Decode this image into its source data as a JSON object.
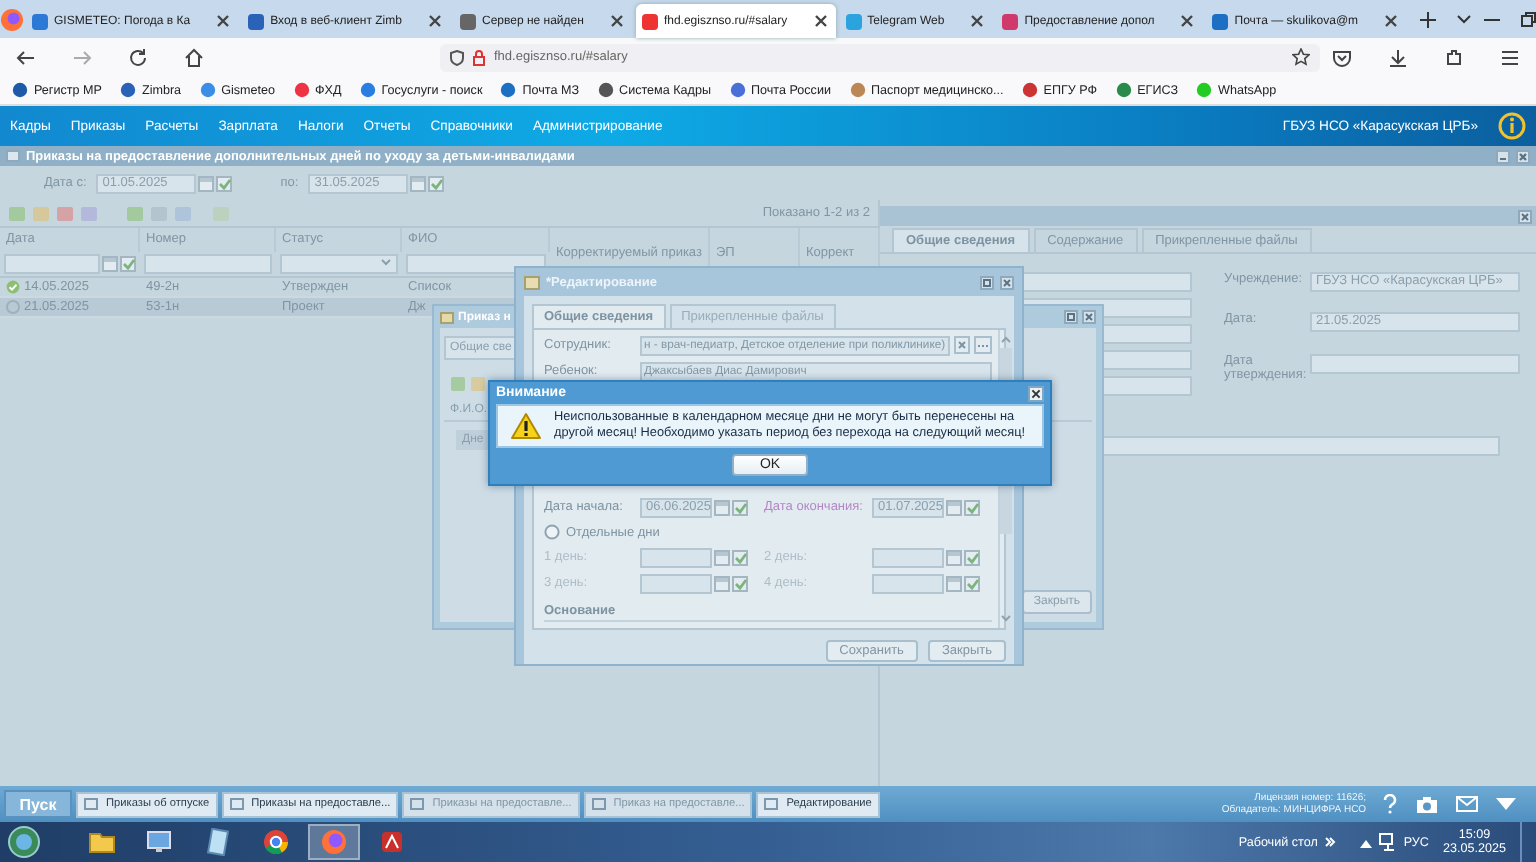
{
  "browser": {
    "tabs": [
      {
        "label": "GISMETEO: Погода в Ка",
        "selected": false
      },
      {
        "label": "Вход в веб-клиент Zimb",
        "selected": false
      },
      {
        "label": "Сервер не найден",
        "selected": false
      },
      {
        "label": "fhd.egisznso.ru/#salary",
        "selected": true
      },
      {
        "label": "Telegram Web",
        "selected": false
      },
      {
        "label": "Предоставление допол",
        "selected": false
      },
      {
        "label": "Почта — skulikova@m",
        "selected": false
      }
    ],
    "address": "fhd.egisznso.ru/#salary",
    "bookmarks": [
      "Регистр МР",
      "Zimbra",
      "Gismeteo",
      "ФХД",
      "Госуслуги - поиск",
      "Почта МЗ",
      "Система Кадры",
      "Почта России",
      "Паспорт медицинско...",
      "ЕПГУ РФ",
      "ЕГИСЗ",
      "WhatsApp"
    ]
  },
  "menu": {
    "items": [
      "Кадры",
      "Приказы",
      "Расчеты",
      "Зарплата",
      "Налоги",
      "Отчеты",
      "Справочники",
      "Администрирование"
    ],
    "organization": "ГБУЗ НСО «Карасукская ЦРБ»"
  },
  "main_window": {
    "title": "Приказы на предоставление дополнительных дней по уходу за детьми-инвалидами",
    "date_from_label": "Дата с:",
    "date_from": "01.05.2025",
    "date_to_label": "по:",
    "date_to": "31.05.2025",
    "shown": "Показано 1-2 из 2",
    "columns": [
      "Дата",
      "Номер",
      "Статус",
      "ФИО",
      "Корректируемый приказ",
      "ЭП",
      "Коррект"
    ],
    "rows": [
      {
        "kind": "approved",
        "selected": false,
        "cells": [
          "14.05.2025",
          "49-2н",
          "Утвержден",
          "Список"
        ]
      },
      {
        "kind": "draft",
        "selected": true,
        "cells": [
          "21.05.2025",
          "53-1н",
          "Проект",
          "Дж"
        ]
      }
    ],
    "detail": {
      "tabs": [
        {
          "label": "Общие сведения",
          "selected": true
        },
        {
          "label": "Содержание",
          "selected": false
        },
        {
          "label": "Прикрепленные файлы",
          "selected": false
        }
      ],
      "fields": [
        {
          "label": "Учреждение:",
          "value": "ГБУЗ НСО «Карасукская ЦРБ»"
        },
        {
          "label": "Дата:",
          "value": "21.05.2025"
        },
        {
          "label": "Дата утверждения:"
        }
      ]
    }
  },
  "order_window": {
    "title": "Приказ н",
    "tab": "Общие све",
    "column": "Ф.И.О.",
    "row_header": "Дне",
    "button": "Закрыть"
  },
  "edit_window": {
    "title": "*Редактирование",
    "tabs": [
      {
        "label": "Общие сведения",
        "selected": true
      },
      {
        "label": "Прикрепленные файлы",
        "selected": false
      }
    ],
    "employee_label": "Сотрудник:",
    "employee": "н - врач-педиатр, Детское отделение при поликлинике)",
    "child_label": "Ребенок:",
    "child": "Джаксыбаев Диас Дамирович",
    "dates": [
      {
        "label": "Дата начала:",
        "value": "06.06.2025",
        "highlighted": false
      },
      {
        "label": "Дата окончания:",
        "value": "01.07.2025",
        "highlighted": true
      }
    ],
    "separate_days": {
      "label": "Отдельные дни",
      "selected": false
    },
    "days": [
      "1 день:",
      "2 день:",
      "3 день:",
      "4 день:"
    ],
    "section": "Основание",
    "buttons": [
      "Сохранить",
      "Закрыть"
    ]
  },
  "alert": {
    "title": "Внимание",
    "message": "Неиспользованные в календарном месяце дни не могут быть перенесены на другой месяц! Необходимо указать период без перехода на следующий месяц!",
    "button": "OK"
  },
  "app_bar": {
    "start": "Пуск",
    "tasks": [
      {
        "label": "Приказы об отпуске",
        "disabled": false
      },
      {
        "label": "Приказы на предоставле...",
        "disabled": false
      },
      {
        "label": "Приказы на предоставле...",
        "disabled": true
      },
      {
        "label": "Приказ на предоставле...",
        "disabled": true
      },
      {
        "label": "Редактирование",
        "disabled": false
      }
    ],
    "license": "Лицензия номер: 11626; Обладатель: МИНЦИФРА НСО"
  },
  "taskbar": {
    "desktop": "Рабочий стол",
    "language": "РУС",
    "time": "15:09",
    "date": "23.05.2025"
  }
}
